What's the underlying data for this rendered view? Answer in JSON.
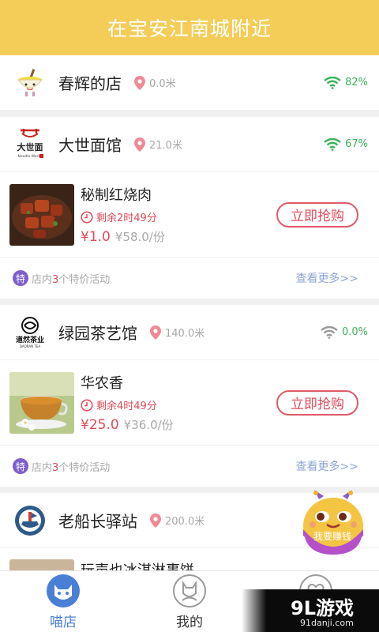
{
  "header": {
    "title": "在宝安江南城附近"
  },
  "shops": [
    {
      "name": "春辉的店",
      "distance": "0.0米",
      "wifi": "82%",
      "logo_icon": "bowl-logo-icon"
    },
    {
      "name": "大世面馆",
      "distance": "21.0米",
      "wifi": "67%",
      "logo_icon": "noodle-works-logo-icon",
      "logo_text": "大世面",
      "logo_subtext": "Noodle Works",
      "deal": {
        "name": "秘制红烧肉",
        "remaining": "剩余2时49分",
        "price": "¥1.0",
        "original_price": "¥58.0/份",
        "buy_label": "立即抢购"
      },
      "promo": {
        "badge": "特",
        "prefix": "店内",
        "count": "3",
        "suffix": "个特价活动",
        "more": "查看更多>>"
      }
    },
    {
      "name": "绿园茶艺馆",
      "distance": "140.0米",
      "wifi": "0.0%",
      "logo_icon": "daoran-tea-logo-icon",
      "logo_text": "道然茶业",
      "logo_subtext": "DAORAN TEA",
      "deal": {
        "name": "华农香",
        "remaining": "剩余4时49分",
        "price": "¥25.0",
        "original_price": "¥36.0/份",
        "buy_label": "立即抢购"
      },
      "promo": {
        "badge": "特",
        "prefix": "店内",
        "count": "3",
        "suffix": "个特价活动",
        "more": "查看更多>>"
      }
    },
    {
      "name": "老船长驿站",
      "distance": "200.0米",
      "logo_icon": "captain-badge-logo-icon",
      "partial_deal_name": "玩声也冰淇淋事饼"
    }
  ],
  "float_button": {
    "label": "我要赚钱",
    "icon": "cartoon-mascot-icon"
  },
  "tabs": [
    {
      "label": "喵店",
      "icon": "cat-face-icon",
      "active": true
    },
    {
      "label": "我的",
      "icon": "user-cat-icon",
      "active": false
    },
    {
      "label": "",
      "icon": "heart-icon",
      "active": false
    }
  ],
  "watermark": {
    "logo": "9L游戏",
    "url": "91danji.com"
  },
  "colors": {
    "header": "#f4cd59",
    "price_red": "#e04a59",
    "wifi_green": "#3cb15a",
    "promo_purple": "#7d5fcc",
    "link_blue": "#8ca6d6",
    "active_tab": "#4a7fd6"
  }
}
